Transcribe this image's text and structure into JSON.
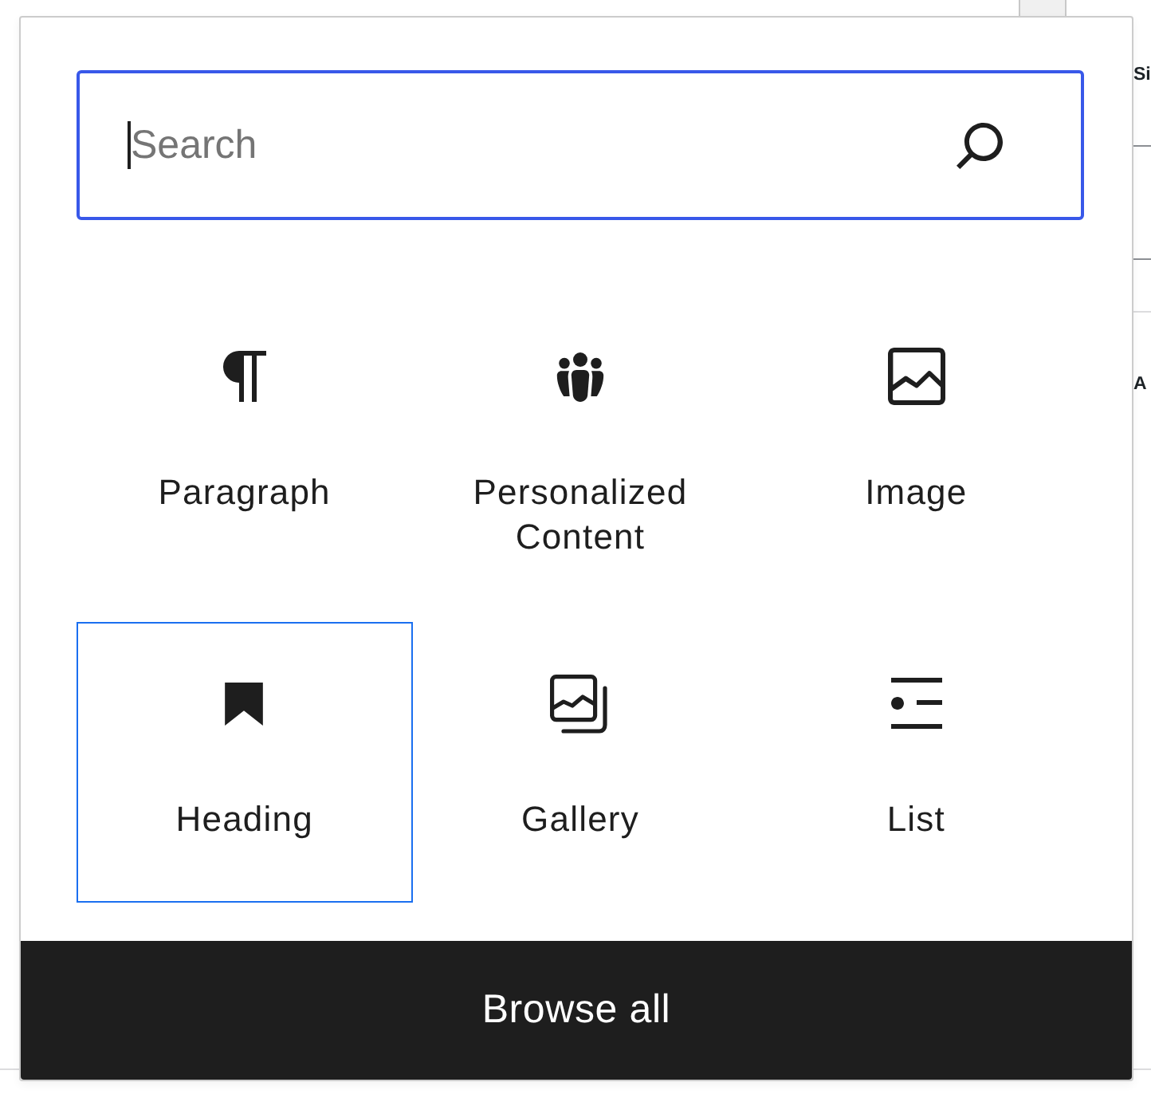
{
  "page_behind": {
    "text_1": "Si",
    "text_2": "A"
  },
  "search": {
    "placeholder": "Search",
    "focused": true
  },
  "blocks": [
    {
      "kind": "paragraph",
      "label": "Paragraph",
      "selected": false
    },
    {
      "kind": "people",
      "label": "Personalized Content",
      "selected": false
    },
    {
      "kind": "image",
      "label": "Image",
      "selected": false
    },
    {
      "kind": "heading",
      "label": "Heading",
      "selected": true
    },
    {
      "kind": "gallery",
      "label": "Gallery",
      "selected": false
    },
    {
      "kind": "list",
      "label": "List",
      "selected": false
    }
  ],
  "browse_button": {
    "label": "Browse all"
  }
}
